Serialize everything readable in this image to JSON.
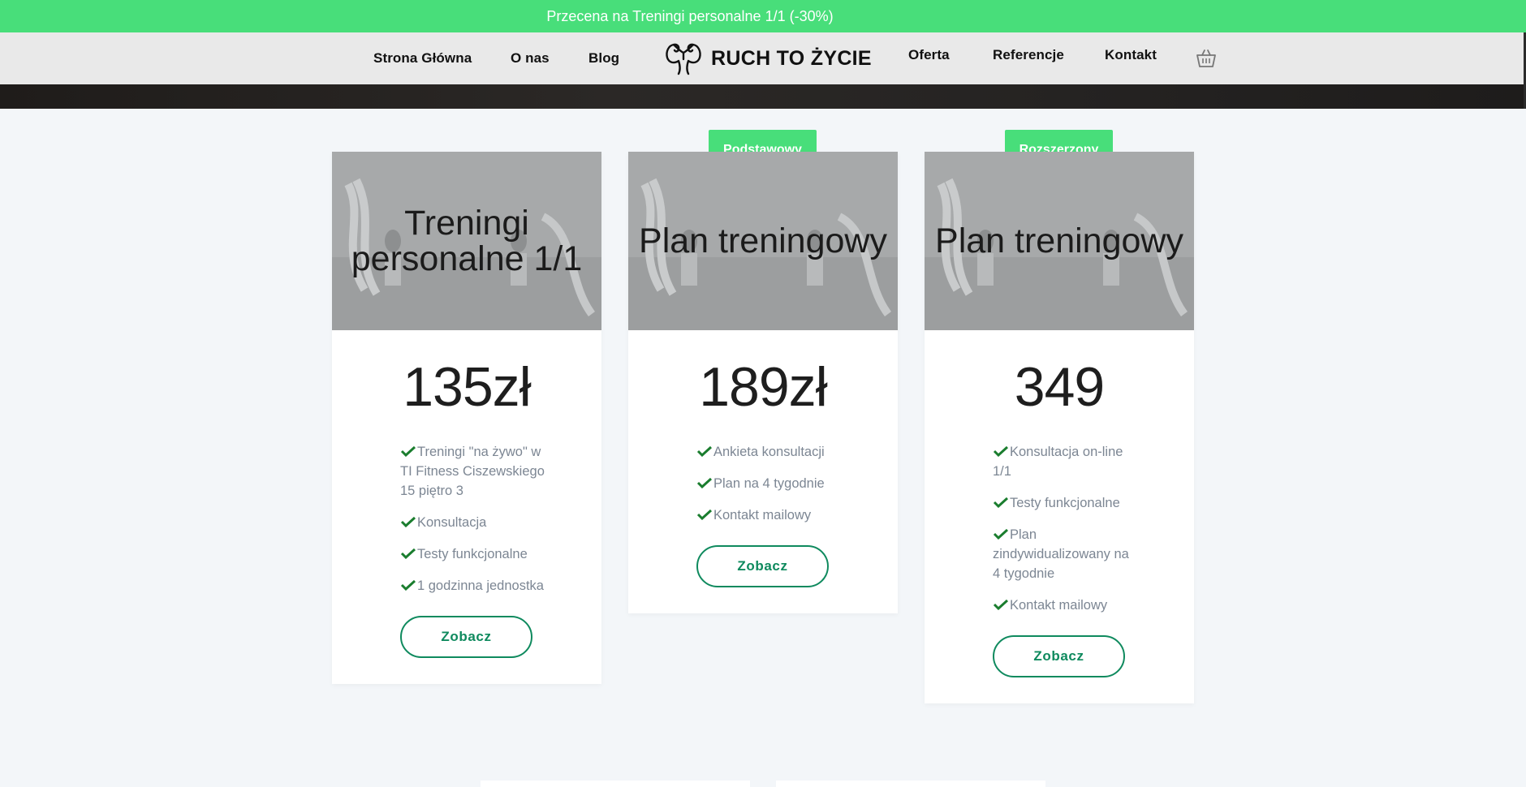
{
  "promo": {
    "text": "Przecena na Treningi personalne 1/1 (-30%)"
  },
  "nav": {
    "left": [
      "Strona Główna",
      "O nas",
      "Blog"
    ],
    "logo_text": "RUCH TO ŻYCIE",
    "right": [
      "Oferta",
      "Referencje",
      "Kontakt"
    ]
  },
  "icons": {
    "logo": "flexing-arms-icon",
    "cart": "basket-icon",
    "check": "check-icon"
  },
  "colors": {
    "accent": "#48de7a",
    "button": "#0f8a5e",
    "check": "#1a7d2e"
  },
  "cards": [
    {
      "badge": "",
      "title": "Treningi personalne 1/1",
      "price": "135zł",
      "features": [
        "Treningi \"na żywo\" w TI Fitness Ciszewskiego 15 piętro 3",
        "Konsultacja",
        "Testy funkcjonalne",
        "1 godzinna jednostka"
      ],
      "button": "Zobacz"
    },
    {
      "badge": "Podstawowy",
      "title": "Plan treningowy",
      "price": "189zł",
      "features": [
        "Ankieta konsultacji",
        "Plan na 4 tygodnie",
        "Kontakt mailowy"
      ],
      "button": "Zobacz"
    },
    {
      "badge": "Rozszerzony",
      "title": "Plan treningowy",
      "price": "349",
      "features": [
        "Konsultacja on-line 1/1",
        "Testy funkcjonalne",
        "Plan zindywidualizowany na 4 tygodnie",
        "Kontakt mailowy"
      ],
      "button": "Zobacz"
    }
  ]
}
